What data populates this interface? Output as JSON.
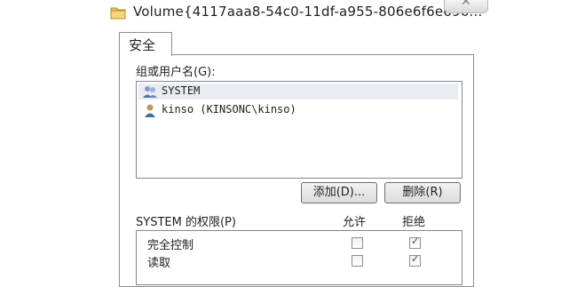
{
  "window": {
    "title": "Volume{4117aaa8-54c0-11df-a955-806e6f6e696..."
  },
  "tabs": [
    {
      "label": "安全"
    }
  ],
  "groups": {
    "label": "组或用户名(G):",
    "items": [
      {
        "name": "SYSTEM",
        "icon": "users-group-icon",
        "selected": true
      },
      {
        "name": "kinso (KINSONC\\kinso)",
        "icon": "user-icon",
        "selected": false
      }
    ]
  },
  "buttons": {
    "add": "添加(D)...",
    "remove": "删除(R)"
  },
  "permissions": {
    "label": "SYSTEM 的权限(P)",
    "allow_header": "允许",
    "deny_header": "拒绝",
    "rows": [
      {
        "name": "完全控制",
        "allow": false,
        "deny": true
      },
      {
        "name": "读取",
        "allow": false,
        "deny": true
      }
    ]
  },
  "colors": {
    "accent": "#2a4b8d",
    "border": "#8e8f8f",
    "selection": "#e9ecf0"
  }
}
